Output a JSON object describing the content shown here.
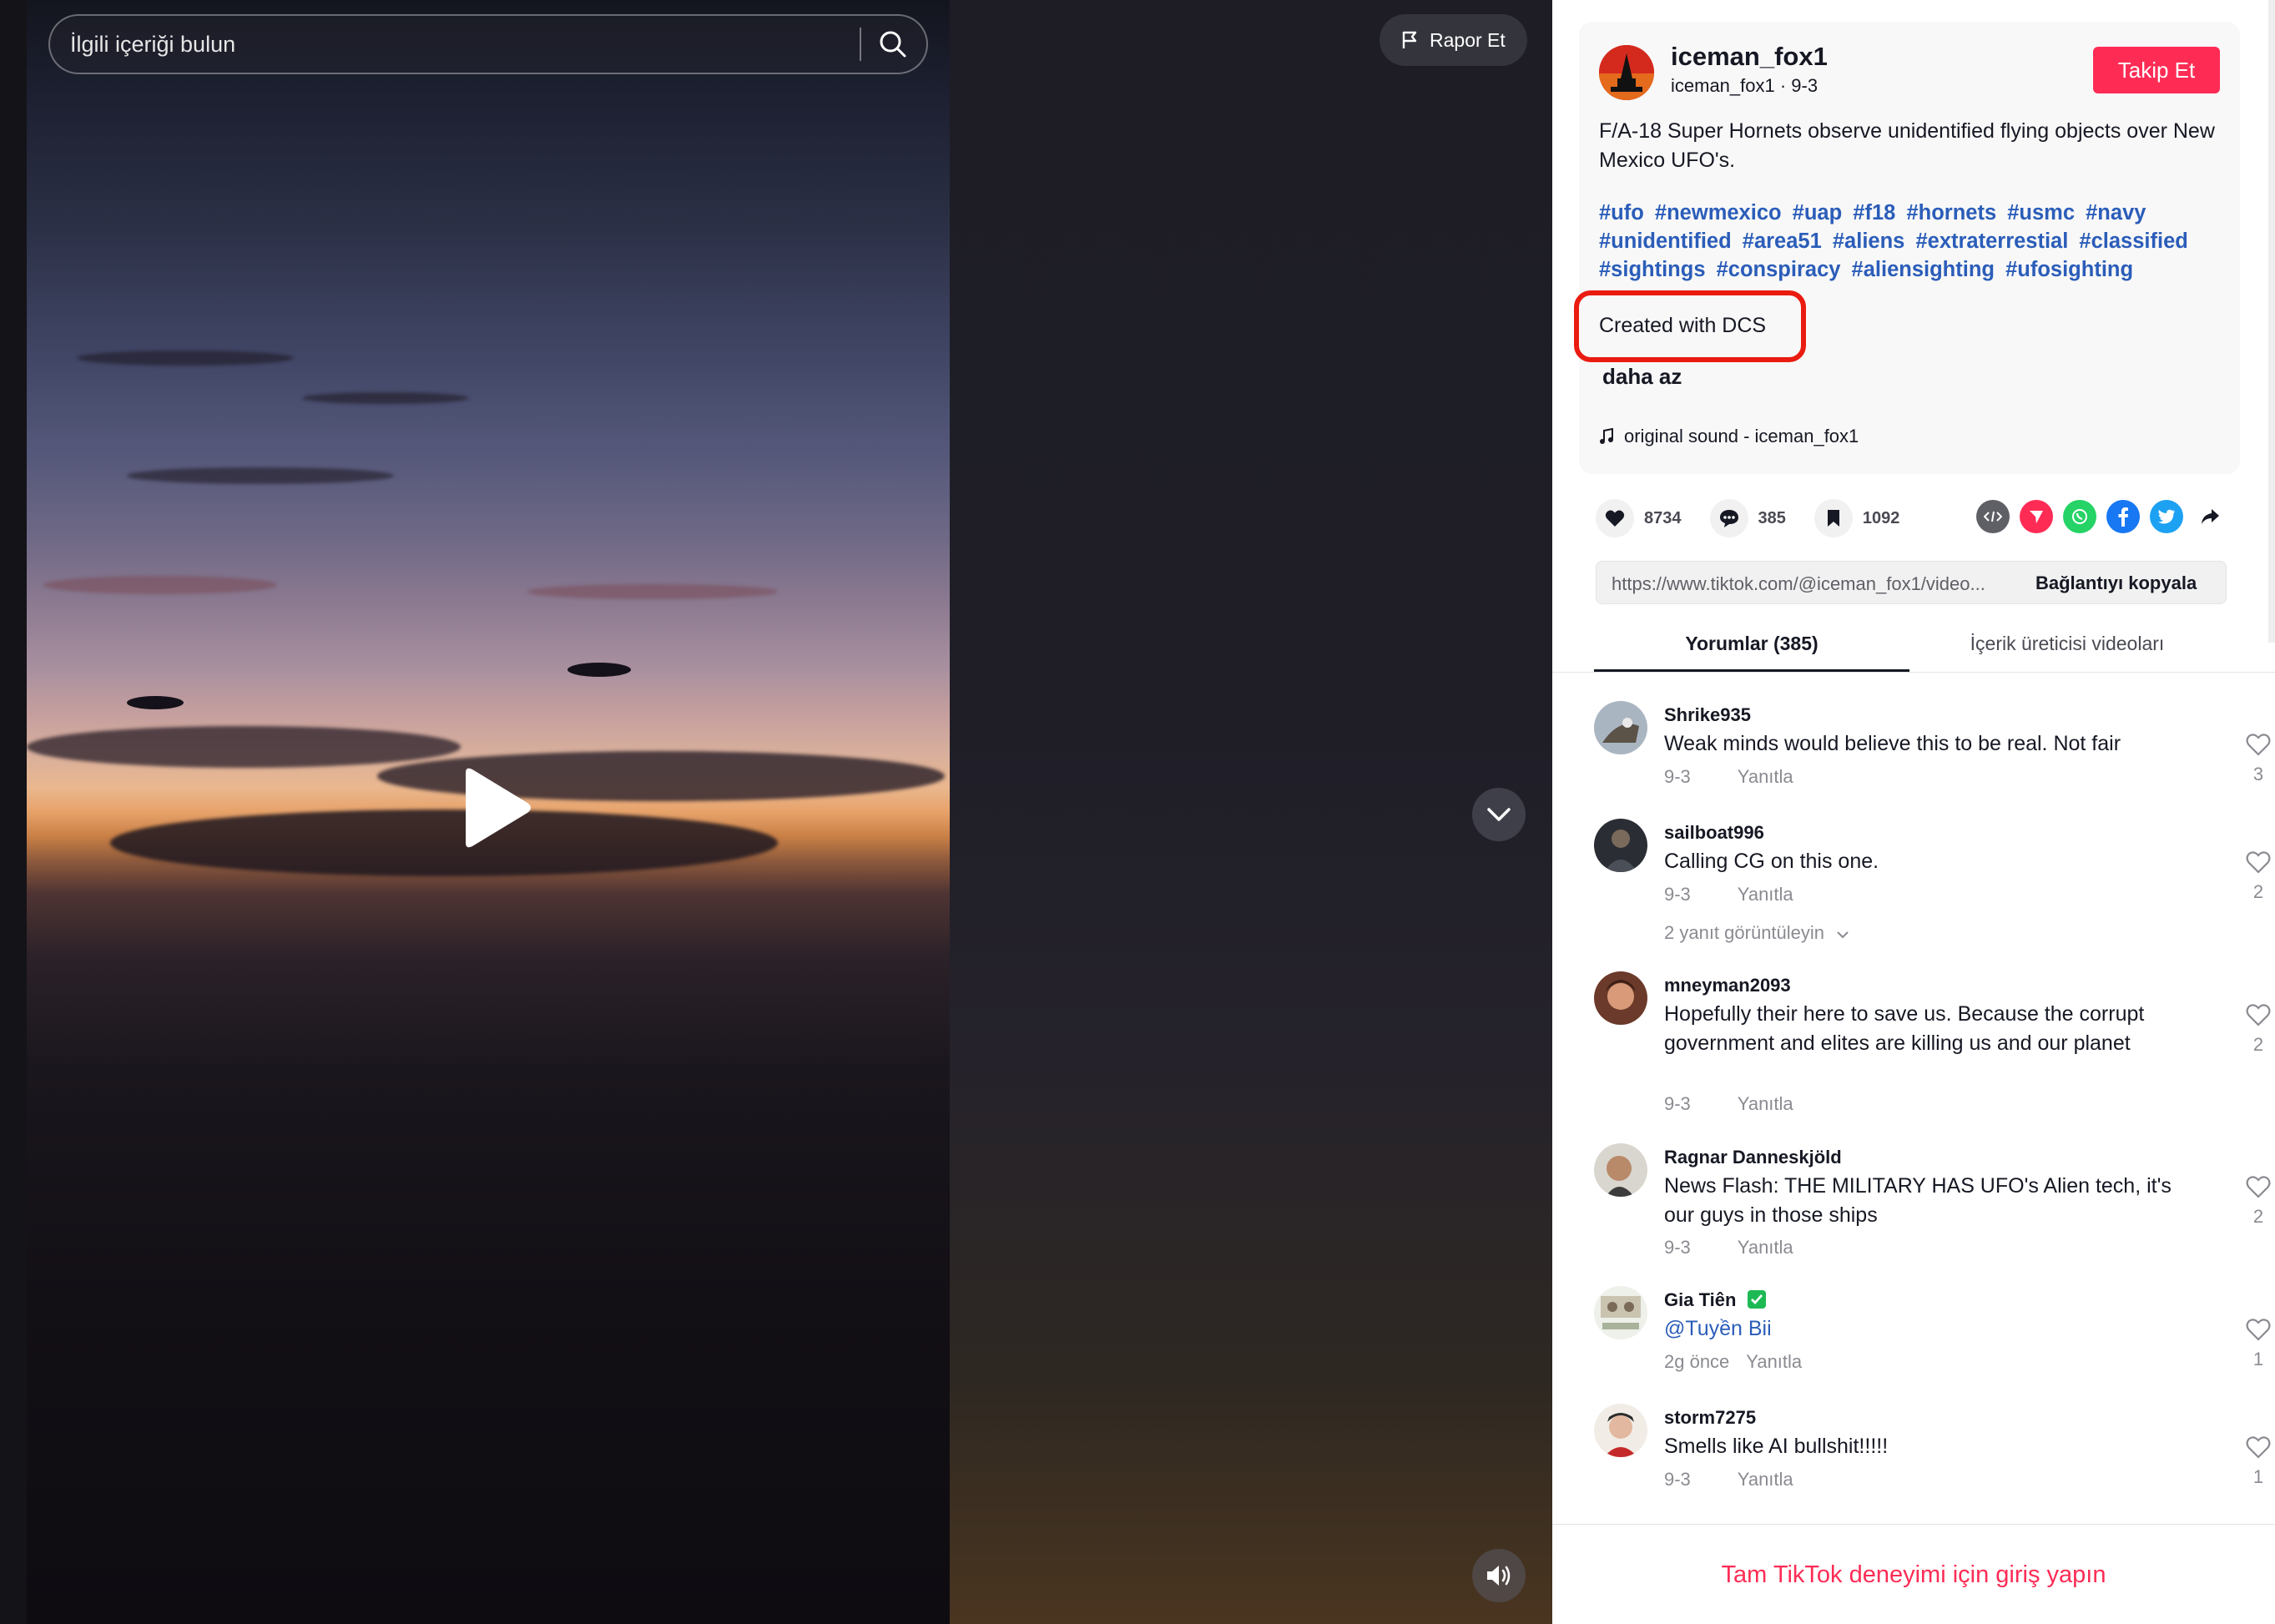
{
  "search": {
    "placeholder": "İlgili içeriği bulun"
  },
  "video": {
    "report_label": "Rapor Et"
  },
  "post": {
    "author_name": "iceman_fox1",
    "author_sub": "iceman_fox1 · 9-3",
    "follow_label": "Takip Et",
    "description": "F/A-18 Super Hornets observe unidentified flying objects over New Mexico UFO's.",
    "hashtags": [
      "#ufo",
      "#newmexico",
      "#uap",
      "#f18",
      "#hornets",
      "#usmc",
      "#navy",
      "#unidentified",
      "#area51",
      "#aliens",
      "#extraterrestial",
      "#classified",
      "#sightings",
      "#conspiracy",
      "#aliensighting",
      "#ufosighting"
    ],
    "created_with": "Created with DCS",
    "less_label": "daha az",
    "music": "original sound - iceman_fox1"
  },
  "actions": {
    "likes": "8734",
    "comments": "385",
    "saves": "1092"
  },
  "share_icons": [
    "embed-icon",
    "send-icon",
    "whatsapp-icon",
    "facebook-icon",
    "twitter-icon",
    "share-arrow-icon"
  ],
  "link": {
    "url": "https://www.tiktok.com/@iceman_fox1/video...",
    "copy_label": "Bağlantıyı kopyala"
  },
  "tabs": {
    "comments": "Yorumlar (385)",
    "creator_videos": "İçerik üreticisi videoları"
  },
  "comments": [
    {
      "user": "Shrike935",
      "text": "Weak minds would believe this to be real. Not fair",
      "date": "9-3",
      "reply": "Yanıtla",
      "likes": "3"
    },
    {
      "user": "sailboat996",
      "text": "Calling CG on this one.",
      "date": "9-3",
      "reply": "Yanıtla",
      "likes": "2",
      "more_replies": "2 yanıt görüntüleyin"
    },
    {
      "user": "mneyman2093",
      "text": "Hopefully their here to save us. Because the corrupt government and elites are killing us and our planet",
      "date": "9-3",
      "reply": "Yanıtla",
      "likes": "2"
    },
    {
      "user": "Ragnar Danneskjöld",
      "text": "News Flash: THE MILITARY HAS UFO's Alien tech, it's our guys in those ships",
      "date": "9-3",
      "reply": "Yanıtla",
      "likes": "2"
    },
    {
      "user": "Gia Tiên",
      "text": "@Tuyền Bii",
      "date": "2g önce",
      "reply": "Yanıtla",
      "likes": "1"
    },
    {
      "user": "storm7275",
      "text": "Smells like AI bullshit!!!!!",
      "date": "9-3",
      "reply": "Yanıtla",
      "likes": "1"
    }
  ],
  "login": {
    "label": "Tam TikTok deneyimi için giriş yapın"
  },
  "colors": {
    "accent": "#fe2c55",
    "hashtag": "#2b5db9",
    "highlight": "#ea1b10"
  }
}
